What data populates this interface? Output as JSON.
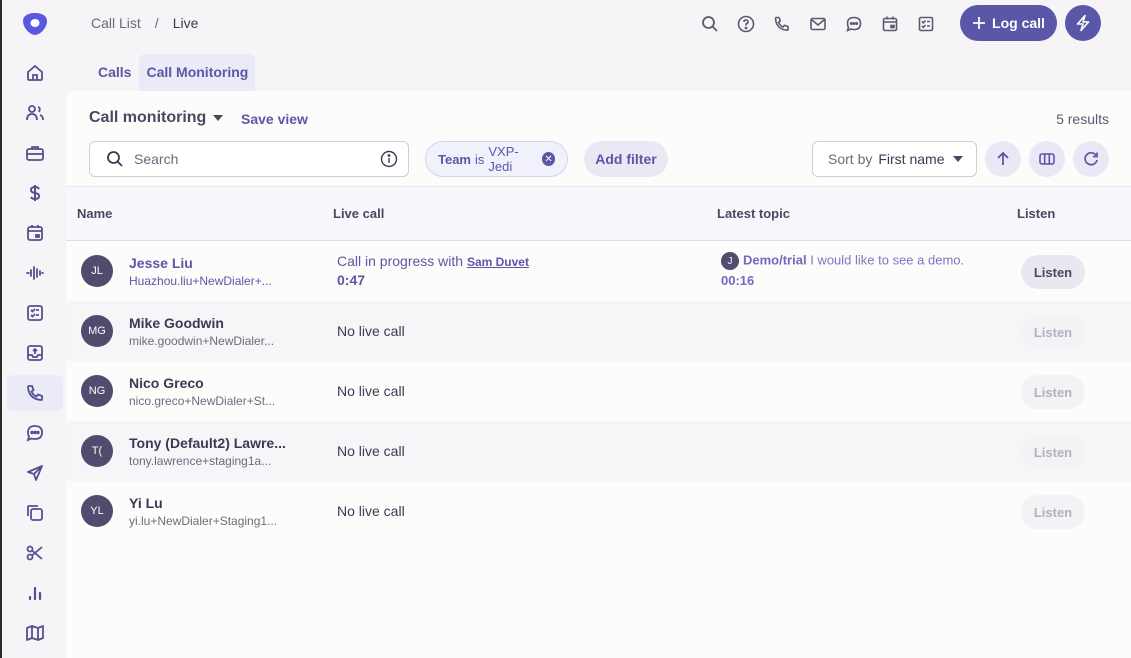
{
  "breadcrumb": {
    "parent": "Call List",
    "separator": "/",
    "current": "Live"
  },
  "topbar": {
    "icons": [
      "search-icon",
      "help-icon",
      "phone-icon",
      "mail-icon",
      "chat-icon",
      "calendar-icon",
      "task-icon"
    ],
    "log_call_label": "Log call",
    "accent": "#5b57a8"
  },
  "sidebar": {
    "items": [
      {
        "icon": "home-icon"
      },
      {
        "icon": "people-icon"
      },
      {
        "icon": "briefcase-icon"
      },
      {
        "icon": "dollar-icon"
      },
      {
        "icon": "calendar-icon"
      },
      {
        "icon": "waveform-icon"
      },
      {
        "icon": "tasks-icon"
      },
      {
        "icon": "inbox-upload-icon"
      },
      {
        "icon": "phone-icon",
        "active": true
      },
      {
        "icon": "chat-icon"
      },
      {
        "icon": "send-icon"
      },
      {
        "icon": "copy-icon"
      },
      {
        "icon": "scissors-icon"
      },
      {
        "icon": "bar-chart-icon"
      },
      {
        "icon": "map-icon"
      }
    ]
  },
  "tabs": [
    {
      "label": "Calls",
      "active": false
    },
    {
      "label": "Call Monitoring",
      "active": true
    }
  ],
  "view": {
    "title": "Call monitoring",
    "save_view": "Save view",
    "results": "5 results"
  },
  "search": {
    "placeholder": "Search",
    "value": ""
  },
  "filter": {
    "field": "Team",
    "op": "is",
    "value": "VXP-Jedi"
  },
  "add_filter": "Add filter",
  "sort": {
    "label": "Sort by",
    "value": "First name"
  },
  "table": {
    "columns": [
      "Name",
      "Live call",
      "Latest topic",
      "Listen"
    ],
    "rows": [
      {
        "initials": "JL",
        "name": "Jesse Liu",
        "email": "Huazhou.liu+NewDialer+...",
        "live": true,
        "live_text": "Call in progress with",
        "live_with": "Sam Duvet",
        "duration": "0:47",
        "topic_initial": "J",
        "topic_name": "Demo/trial",
        "topic_text": "I would like to see a demo.",
        "topic_time": "00:16",
        "listen": "Listen",
        "listen_enabled": true
      },
      {
        "initials": "MG",
        "name": "Mike Goodwin",
        "email": "mike.goodwin+NewDialer...",
        "live": false,
        "live_text": "No live call",
        "listen": "Listen",
        "listen_enabled": false
      },
      {
        "initials": "NG",
        "name": "Nico Greco",
        "email": "nico.greco+NewDialer+St...",
        "live": false,
        "live_text": "No live call",
        "listen": "Listen",
        "listen_enabled": false
      },
      {
        "initials": "T(",
        "name": "Tony (Default2) Lawre...",
        "email": "tony.lawrence+staging1a...",
        "live": false,
        "live_text": "No live call",
        "listen": "Listen",
        "listen_enabled": false
      },
      {
        "initials": "YL",
        "name": "Yi Lu",
        "email": "yi.lu+NewDialer+Staging1...",
        "live": false,
        "live_text": "No live call",
        "listen": "Listen",
        "listen_enabled": false
      }
    ]
  }
}
